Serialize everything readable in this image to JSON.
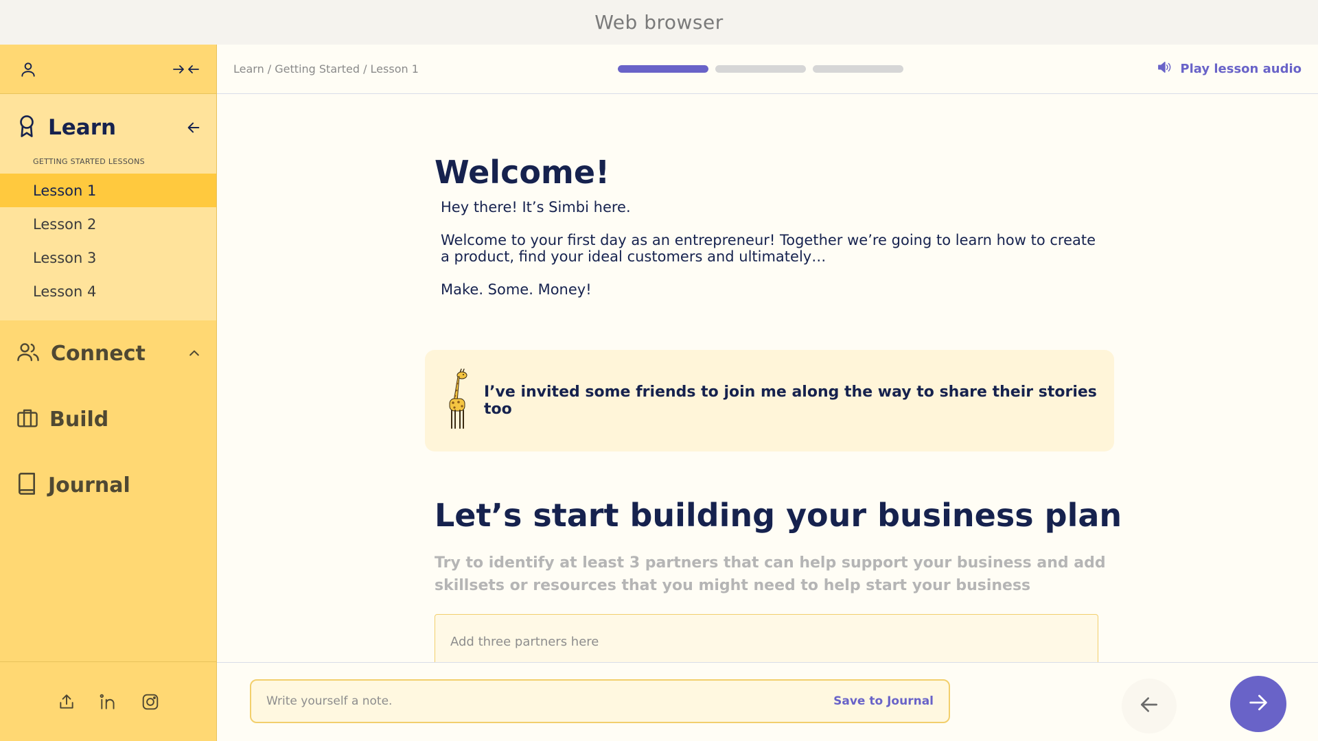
{
  "browser": {
    "title": "Web browser"
  },
  "sidebar": {
    "top": {
      "profile_icon": "user-icon",
      "collapse_icon": "collapse-arrows-icon"
    },
    "learn": {
      "label": "Learn",
      "icon": "award-ribbon-icon",
      "section_label": "GETTING STARTED LESSONS",
      "lessons": [
        {
          "label": "Lesson 1",
          "active": true
        },
        {
          "label": "Lesson 2",
          "active": false
        },
        {
          "label": "Lesson 3",
          "active": false
        },
        {
          "label": "Lesson 4",
          "active": false
        }
      ]
    },
    "nav": [
      {
        "label": "Connect",
        "icon": "users-icon"
      },
      {
        "label": "Build",
        "icon": "briefcase-icon"
      },
      {
        "label": "Journal",
        "icon": "book-icon"
      }
    ],
    "social": [
      "share-icon",
      "linkedin-icon",
      "instagram-icon"
    ]
  },
  "topbar": {
    "breadcrumb": "Learn / Getting Started / Lesson 1",
    "progress": [
      1,
      0,
      0
    ],
    "audio_label": "Play lesson audio"
  },
  "content": {
    "welcome_title": "Welcome!",
    "intro": [
      "Hey there! It’s Simbi here.",
      "Welcome to your first day as an entrepreneur! Together we’re going to learn how to create a product, find your ideal customers and ultimately…",
      "Make. Some. Money!"
    ],
    "callout_text": "I’ve invited some friends to join me along the way to share their stories too",
    "plan_title": "Let’s start building your business plan",
    "instruction": "Try to identify at least 3 partners that can help support your business and add skillsets or resources that you might need to help start your business",
    "partners_placeholder": "Add three partners here"
  },
  "bottombar": {
    "note_placeholder": "Write yourself a note.",
    "save_label": "Save to Journal"
  },
  "colors": {
    "sidebar": "#ffd873",
    "sidebar_active": "#ffc93e",
    "accent": "#6963c8",
    "navy": "#16224e"
  }
}
